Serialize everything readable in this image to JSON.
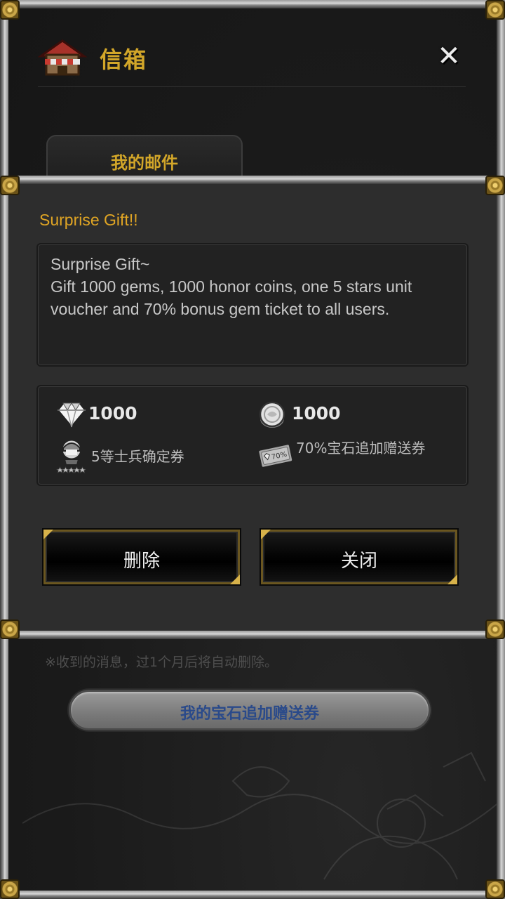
{
  "mailbox": {
    "title": "信箱",
    "tab_label": "我的邮件",
    "notice": "※收到的消息，过1个月后将自动删除。",
    "gem_ticket_button": "我的宝石追加赠送券"
  },
  "dialog": {
    "title": "Surprise Gift!!",
    "message": "Surprise Gift~\nGift 1000 gems, 1000 honor coins, one 5 stars unit voucher and 70% bonus gem ticket to all users.",
    "rewards": [
      {
        "icon": "diamond-icon",
        "label": "1000"
      },
      {
        "icon": "honor-coin-icon",
        "label": "1000"
      },
      {
        "icon": "soldier-voucher-icon",
        "label": "5等士兵确定券"
      },
      {
        "icon": "gem-ticket-icon",
        "label": "70%宝石追加赠送券",
        "badge": "70%"
      }
    ],
    "delete_button": "删除",
    "close_button": "关闭"
  },
  "colors": {
    "gold_text": "#d2a629",
    "title_orange": "#e0a524",
    "panel": "#2d2d2d",
    "blue_text": "#2a4a8a"
  }
}
